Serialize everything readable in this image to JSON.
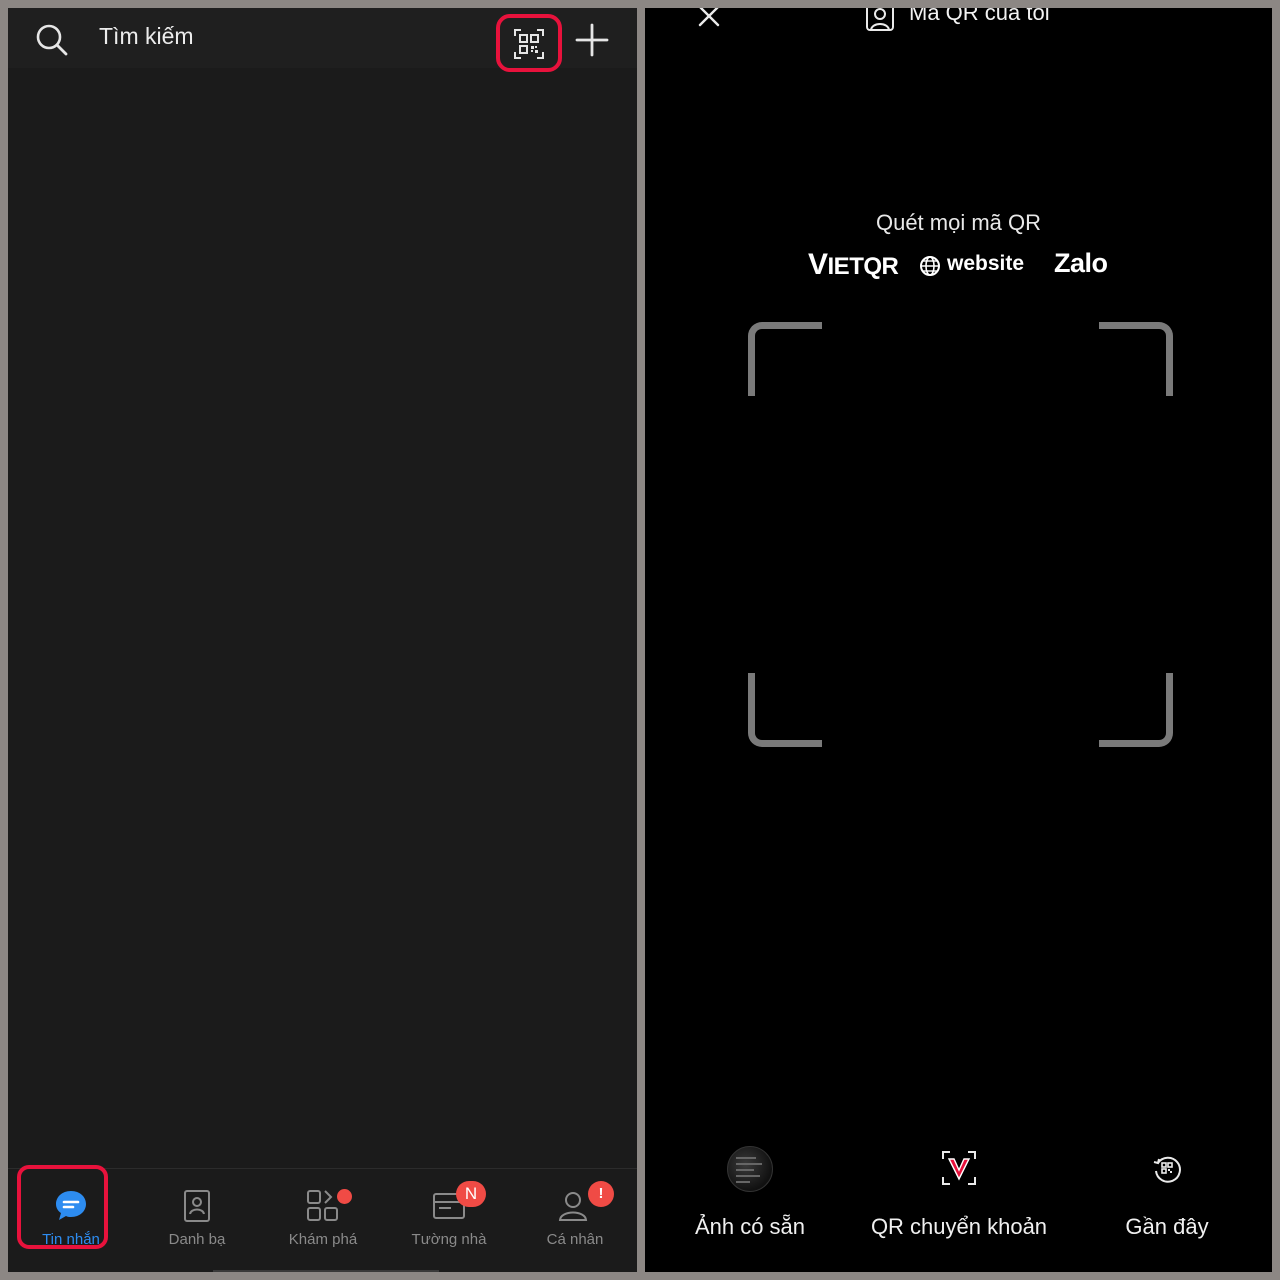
{
  "left_screen": {
    "search": {
      "placeholder": "Tìm kiếm",
      "icon": "search-icon"
    },
    "qr_scan_button": {
      "icon": "qr-scan-icon",
      "highlighted": true,
      "highlight_color": "#e8123c"
    },
    "add_button": {
      "icon": "plus-icon"
    },
    "bottom_nav": [
      {
        "label": "Tin nhắn",
        "icon": "chat-bubble-icon",
        "active": true
      },
      {
        "label": "Danh bạ",
        "icon": "contacts-icon",
        "active": false
      },
      {
        "label": "Khám phá",
        "icon": "explore-grid-icon",
        "active": false,
        "badge_dot": true
      },
      {
        "label": "Tường nhà",
        "icon": "timeline-icon",
        "active": false,
        "badge": "N"
      },
      {
        "label": "Cá nhân",
        "icon": "profile-icon",
        "active": false,
        "badge": "!"
      }
    ],
    "colors": {
      "active": "#2d8cf0",
      "badge": "#f04b45",
      "highlight": "#e8123c"
    }
  },
  "right_screen": {
    "close_icon": "close-icon",
    "my_qr": {
      "label": "Mã QR của tôi",
      "icon": "user-qr-icon"
    },
    "scan_title": "Quét mọi mã QR",
    "logos": {
      "vietqr_initial": "V",
      "vietqr_rest": "IETQR",
      "website": "website",
      "zalo": "Zalo"
    },
    "actions": [
      {
        "label": "Ảnh có sẵn",
        "icon": "gallery-thumbnail"
      },
      {
        "label": "QR chuyển khoản",
        "icon": "vietqr-transfer-icon"
      },
      {
        "label": "Gần đây",
        "icon": "recent-qr-icon"
      }
    ]
  }
}
